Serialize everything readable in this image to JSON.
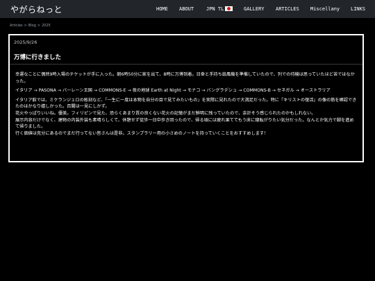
{
  "header": {
    "site_title": "やがらねっと",
    "nav": [
      {
        "label": "HOME"
      },
      {
        "label": "ABOUT"
      },
      {
        "label": "JPN TL"
      },
      {
        "label": "GALLERY"
      },
      {
        "label": "ARTICLES"
      },
      {
        "label": "Miscellany"
      },
      {
        "label": "LINKS"
      }
    ]
  },
  "breadcrumb": [
    "Articles",
    ">",
    "Blog",
    ">",
    "2025"
  ],
  "post": {
    "date": "2025/9/26",
    "title": "万博に行きました",
    "paragraphs": [
      "幸運なことに偶然9時入場のチケットが手に入った。朝6時50分に家を出て、8時に万博到着。日傘と手持ち扇風機を準備していたので、列での待機は思っていたほど苦ではなかった。",
      "イタリア → PASONA → バーレーン王国 → COMMONS-E → 夜の地球 Earth at Night → モナコ → バングラデシュ → COMMONS-B → セネガル → オーストラリア",
      "イタリア館では、ミケランジェロの彫刻など、「一生に一度は本物を自分の目で見てみたいもの」を実際に見れたので大満足だった。特に『キリストの復活』の像の筋を確認できたのはかなり嬉しかった。百聞は一見にしかず。",
      "花火やっぱりいいね。優美。フィリピンで見た、恐らくあまり質の良くない花火の記憶がまだ鮮明に残っていたので、余計そう感じられたのかもしれない。",
      "展示内容だけでなく、建物の内装外装も素晴らしくて、休憩せず徒歩一日中歩き回ったので、帰る頃には疲れ果ててもう床に寝転がりたい気分だった。なんとか気力で脚を進めて帰りました。",
      "行く価値は充分にあるのでまだ行ってない皆さんは是非。スタンプラリー用の小さめのノートを持っていくことをおすすめします！"
    ]
  },
  "colors": {
    "topbar": "#22262b",
    "background": "#000000",
    "flag_red": "#d61a1a"
  }
}
